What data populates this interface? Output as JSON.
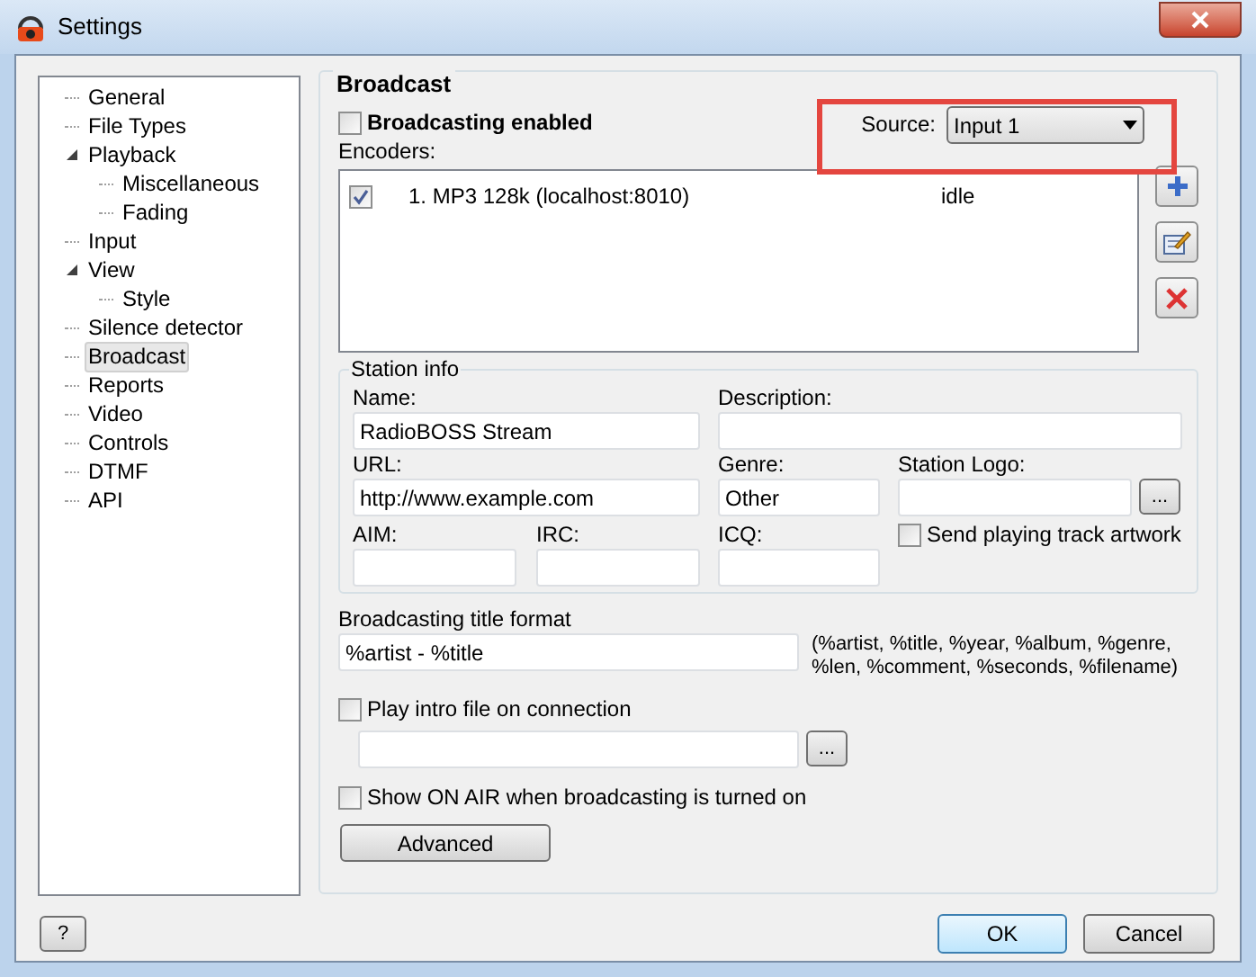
{
  "window": {
    "title": "Settings"
  },
  "tree": [
    {
      "label": "General",
      "selected": false
    },
    {
      "label": "File Types",
      "selected": false
    },
    {
      "label": "Playback",
      "selected": false,
      "expanded": true,
      "children": [
        {
          "label": "Miscellaneous",
          "selected": false
        },
        {
          "label": "Fading",
          "selected": false
        }
      ]
    },
    {
      "label": "Input",
      "selected": false
    },
    {
      "label": "View",
      "selected": false,
      "expanded": true,
      "children": [
        {
          "label": "Style",
          "selected": false
        }
      ]
    },
    {
      "label": "Silence detector",
      "selected": false
    },
    {
      "label": "Broadcast",
      "selected": true
    },
    {
      "label": "Reports",
      "selected": false
    },
    {
      "label": "Video",
      "selected": false
    },
    {
      "label": "Controls",
      "selected": false
    },
    {
      "label": "DTMF",
      "selected": false
    },
    {
      "label": "API",
      "selected": false
    }
  ],
  "page": {
    "title": "Broadcast",
    "broadcasting_enabled": {
      "label": "Broadcasting enabled",
      "checked": false
    },
    "source": {
      "label": "Source:",
      "value": "Input 1",
      "highlighted": true
    },
    "encoders": {
      "label": "Encoders:",
      "rows": [
        {
          "checked": true,
          "name": "1. MP3 128k (localhost:8010)",
          "status": "idle"
        }
      ]
    },
    "station_info": {
      "title": "Station info",
      "name": {
        "label": "Name:",
        "value": "RadioBOSS Stream"
      },
      "description": {
        "label": "Description:"
      },
      "url": {
        "label": "URL:",
        "value": "http://www.example.com"
      },
      "genre": {
        "label": "Genre:",
        "value": "Other"
      },
      "station_logo": {
        "label": "Station Logo:",
        "browse": "..."
      },
      "aim": {
        "label": "AIM:"
      },
      "irc": {
        "label": "IRC:"
      },
      "icq": {
        "label": "ICQ:"
      },
      "send_artwork": {
        "label": "Send playing track artwork",
        "checked": false
      }
    },
    "title_format": {
      "label": "Broadcasting title format",
      "value": "%artist - %title",
      "hint_lines": [
        "(%artist, %title, %year, %album, %genre,",
        "%len, %comment, %seconds, %filename)"
      ]
    },
    "play_intro": {
      "label": "Play intro file on connection",
      "checked": false,
      "browse": "..."
    },
    "show_on_air": {
      "label": "Show ON AIR when broadcasting is turned on",
      "checked": false
    },
    "advanced_button": "Advanced"
  },
  "buttons": {
    "help": "?",
    "ok": "OK",
    "cancel": "Cancel"
  }
}
